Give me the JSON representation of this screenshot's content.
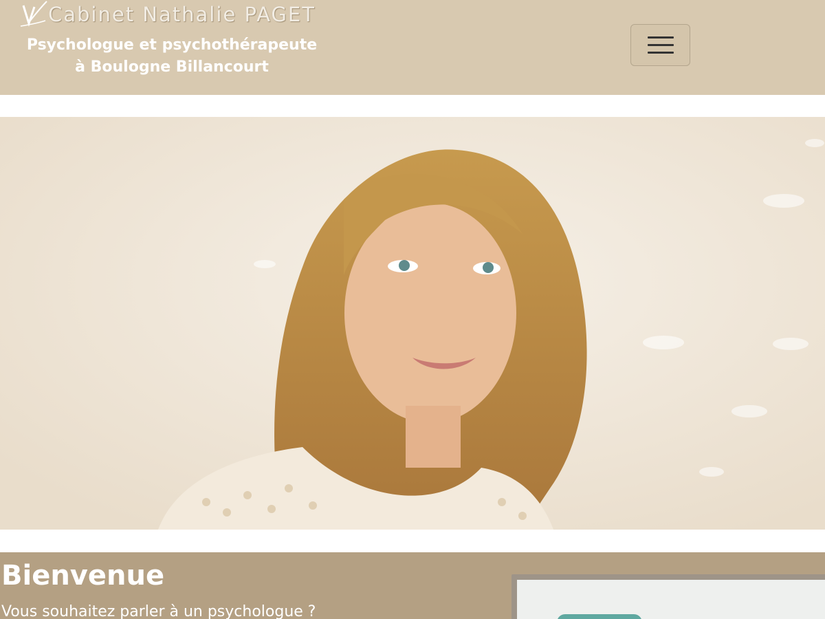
{
  "header": {
    "logo_text": "Cabinet Nathalie PAGET",
    "tagline": "Psychologue et psychothérapeute à Boulogne Billancourt",
    "menu_button_icon": "hamburger-icon"
  },
  "hero": {
    "image": "portrait-photo"
  },
  "welcome": {
    "title": "Bienvenue",
    "intro": "Vous souhaitez parler à un psychologue ?"
  },
  "colors": {
    "header_bg": "#d8c9b0",
    "welcome_bg": "#b4a083",
    "text_light": "#ffffff"
  }
}
